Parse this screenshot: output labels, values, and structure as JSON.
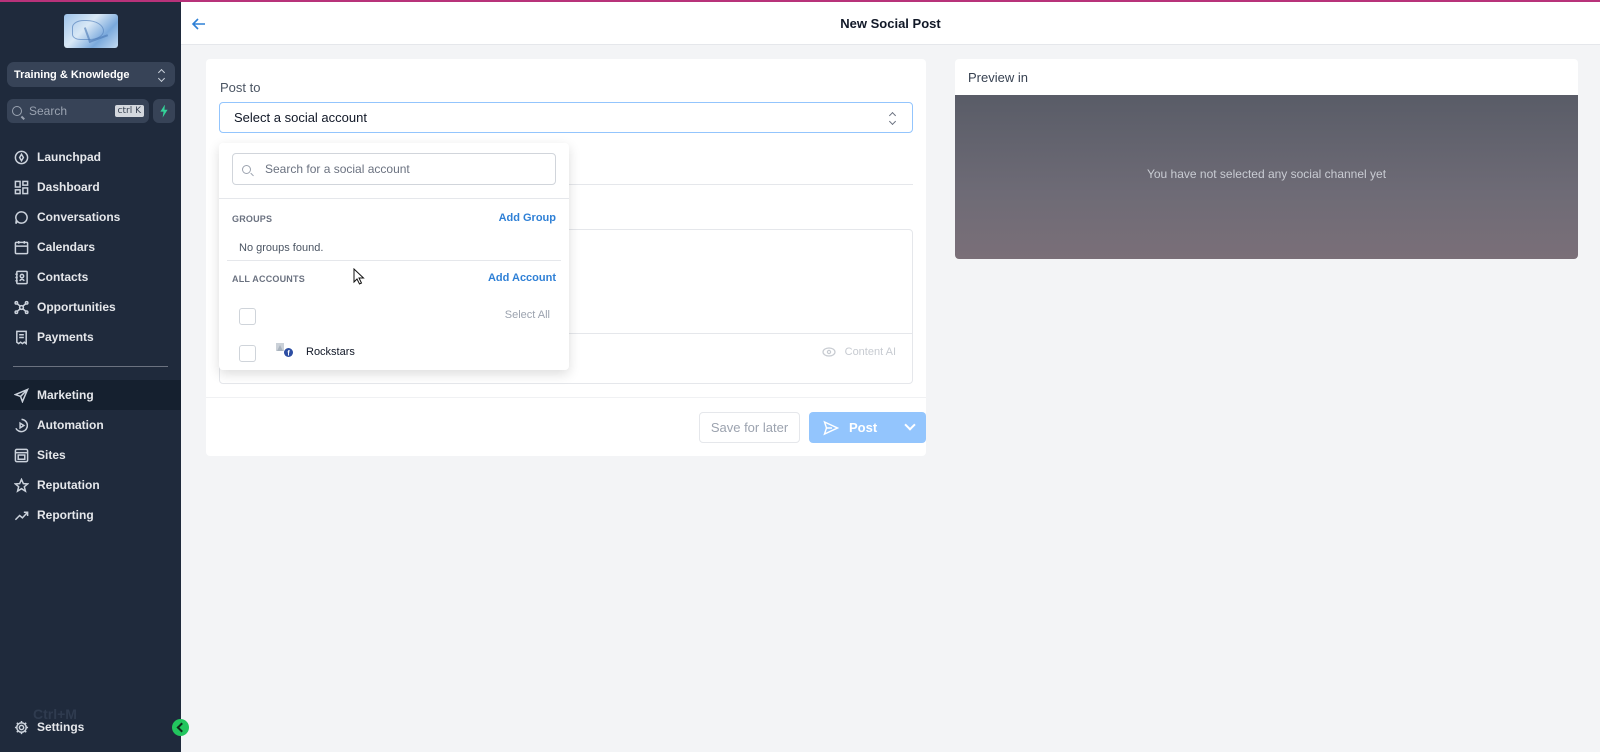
{
  "sidebar": {
    "account_name": "Training & Knowledge",
    "search_label": "Search",
    "search_shortcut": "ctrl K",
    "nav_top": [
      {
        "label": "Launchpad",
        "icon": "rocket-icon"
      },
      {
        "label": "Dashboard",
        "icon": "grid-icon"
      },
      {
        "label": "Conversations",
        "icon": "chat-icon"
      },
      {
        "label": "Calendars",
        "icon": "calendar-icon"
      },
      {
        "label": "Contacts",
        "icon": "contacts-icon"
      },
      {
        "label": "Opportunities",
        "icon": "network-icon"
      },
      {
        "label": "Payments",
        "icon": "receipt-icon"
      }
    ],
    "nav_bottom": [
      {
        "label": "Marketing",
        "icon": "send-icon",
        "active": true
      },
      {
        "label": "Automation",
        "icon": "automation-icon"
      },
      {
        "label": "Sites",
        "icon": "sites-icon"
      },
      {
        "label": "Reputation",
        "icon": "star-icon"
      },
      {
        "label": "Reporting",
        "icon": "trend-icon"
      }
    ],
    "shortcut_hint": "Ctrl+M",
    "settings_label": "Settings",
    "accent_color": "#22c55e"
  },
  "header": {
    "title": "New Social Post"
  },
  "composer": {
    "post_to_label": "Post to",
    "account_select_value": "Select a social account",
    "content_ai_label": "Content AI",
    "save_for_later_label": "Save for later",
    "post_label": "Post",
    "primary_color": "#93c5fd"
  },
  "dropdown": {
    "search_placeholder": "Search for a social account",
    "groups_heading": "GROUPS",
    "add_group_label": "Add Group",
    "no_groups_text": "No groups found.",
    "all_accounts_heading": "ALL ACCOUNTS",
    "add_account_label": "Add Account",
    "select_all_label": "Select All",
    "accounts": [
      {
        "name": "Rockstars",
        "network": "facebook"
      }
    ]
  },
  "preview": {
    "title": "Preview in",
    "empty_message": "You have not selected any social channel yet"
  }
}
